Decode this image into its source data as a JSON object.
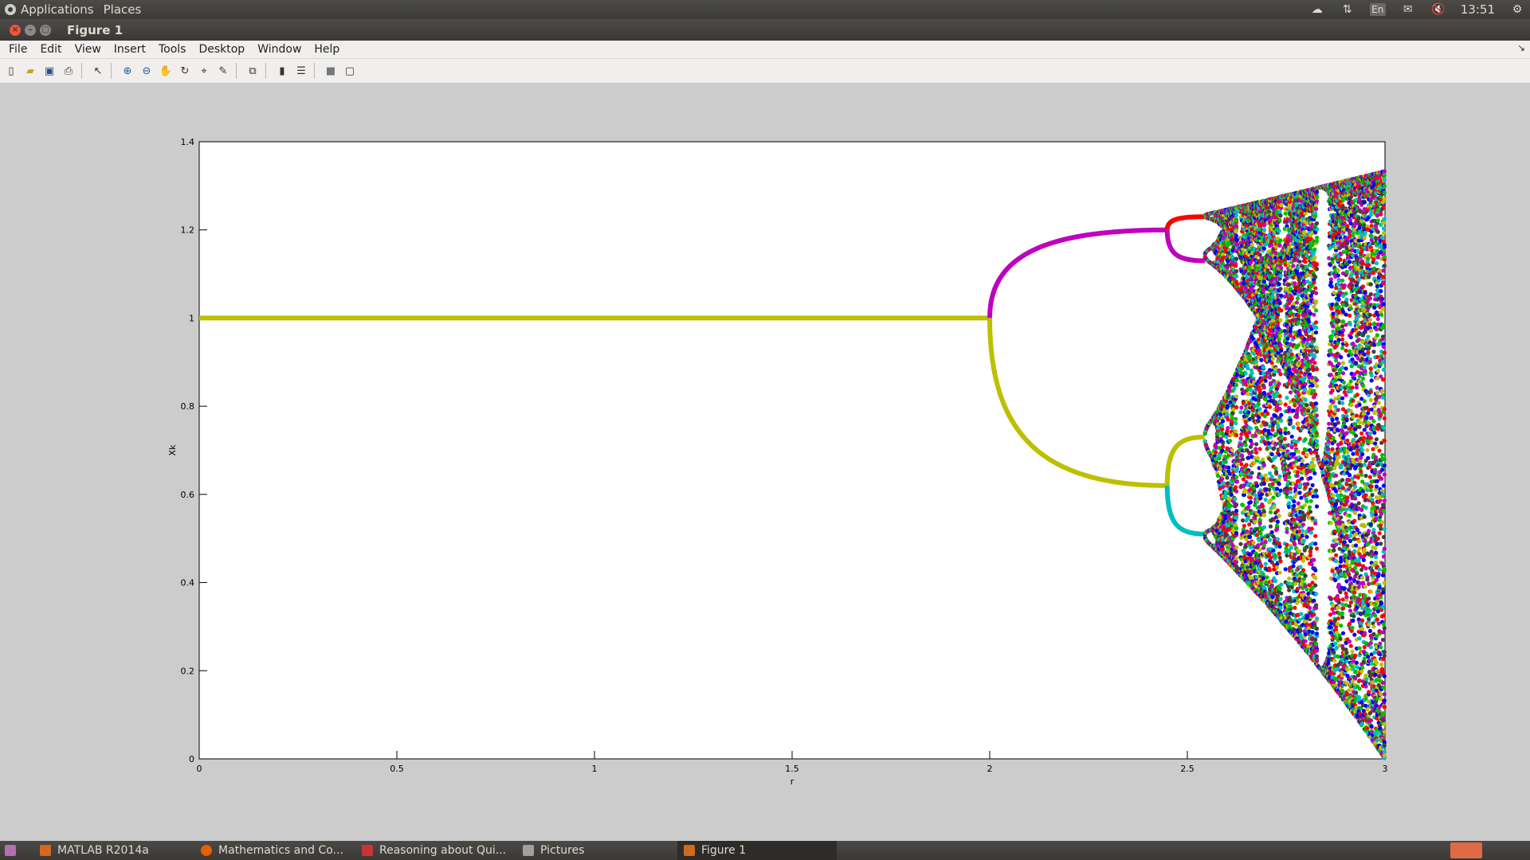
{
  "topbar": {
    "menus": [
      "Applications",
      "Places"
    ],
    "time": "13:51",
    "tray_icons": [
      "weather-icon",
      "network-icon",
      "keyboard-icon",
      "mail-icon",
      "volume-icon",
      "gear-icon"
    ],
    "keyboard_label": "En"
  },
  "window": {
    "title": "Figure 1"
  },
  "menubar": {
    "items": [
      "File",
      "Edit",
      "View",
      "Insert",
      "Tools",
      "Desktop",
      "Window",
      "Help"
    ]
  },
  "toolbar": {
    "buttons": [
      "new-figure-icon",
      "open-icon",
      "save-icon",
      "print-icon",
      "pointer-icon",
      "zoom-in-icon",
      "zoom-out-icon",
      "pan-icon",
      "rotate-icon",
      "data-cursor-icon",
      "brush-icon",
      "link-icon",
      "colorbar-icon",
      "legend-icon",
      "hide-tools-icon",
      "show-tools-icon"
    ]
  },
  "chart_data": {
    "type": "scatter",
    "title": "",
    "xlabel": "r",
    "ylabel": "Xk",
    "xlim": [
      0,
      3
    ],
    "ylim": [
      0,
      1.4
    ],
    "xticks": [
      "0",
      "0.5",
      "1",
      "1.5",
      "2",
      "2.5",
      "3"
    ],
    "yticks": [
      "0",
      "0.2",
      "0.4",
      "0.6",
      "0.8",
      "1",
      "1.2",
      "1.4"
    ],
    "grid": false,
    "legend": "none",
    "description_of_data": "bifurcation diagram x_{k+1}=x_k+r x_k(1-x_k)",
    "stable_branch": {
      "r_range": [
        0,
        2
      ],
      "x": 1.0,
      "color": "#bfbf00"
    },
    "period2_branches": [
      {
        "r_range": [
          2,
          2.449
        ],
        "x_start": 1.0,
        "x_end": 1.2,
        "color": "#bf00bf"
      },
      {
        "r_range": [
          2,
          2.449
        ],
        "x_start": 1.0,
        "x_end": 0.62,
        "color": "#bfbf00"
      }
    ],
    "period4_branches": [
      {
        "r_range": [
          2.449,
          2.544
        ],
        "x_start": 1.2,
        "x_end": 1.23,
        "color": "#ff0000"
      },
      {
        "r_range": [
          2.449,
          2.544
        ],
        "x_start": 1.2,
        "x_end": 1.13,
        "color": "#bf00bf"
      },
      {
        "r_range": [
          2.449,
          2.544
        ],
        "x_start": 0.62,
        "x_end": 0.73,
        "color": "#bfbf00"
      },
      {
        "r_range": [
          2.449,
          2.544
        ],
        "x_start": 0.62,
        "x_end": 0.51,
        "color": "#00bfbf"
      }
    ],
    "chaos_region": {
      "r_range": [
        2.57,
        3.0
      ],
      "x_min_at_start": 0.5,
      "x_max_at_start": 1.24,
      "x_min_at_end": 0.0,
      "x_max_at_end": 1.34
    },
    "periodic_window_r": 2.83,
    "colors": [
      "#ff0000",
      "#00bf00",
      "#0000ff",
      "#bf00bf",
      "#00bfbf",
      "#bfbf00",
      "#404040"
    ]
  },
  "taskbar": {
    "tasks": [
      {
        "label": "MATLAB R2014a",
        "icon": "matlab-icon"
      },
      {
        "label": "Mathematics and Co...",
        "icon": "firefox-icon"
      },
      {
        "label": "Reasoning about Qui...",
        "icon": "pdf-icon"
      },
      {
        "label": "Pictures",
        "icon": "folder-icon"
      },
      {
        "label": "Figure 1",
        "icon": "matlab-figure-icon",
        "active": true
      }
    ]
  }
}
